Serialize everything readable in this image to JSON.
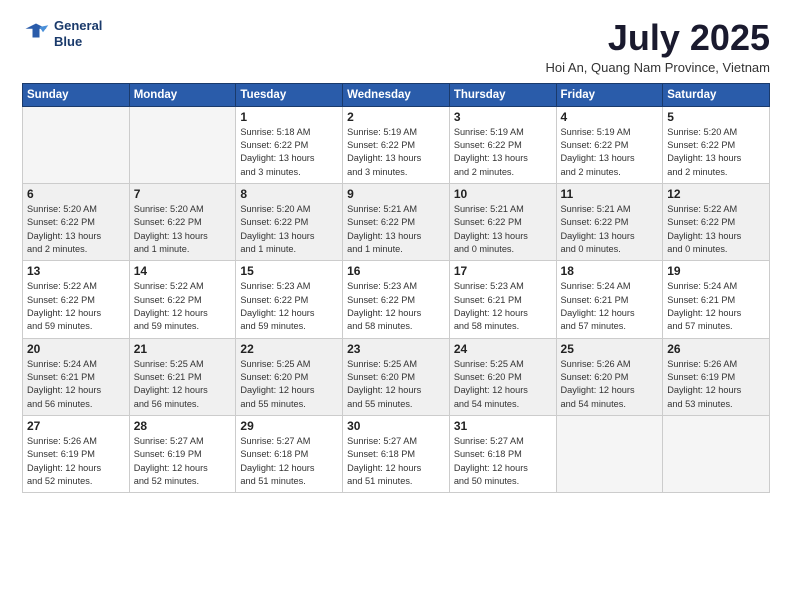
{
  "logo": {
    "line1": "General",
    "line2": "Blue"
  },
  "title": "July 2025",
  "subtitle": "Hoi An, Quang Nam Province, Vietnam",
  "weekdays": [
    "Sunday",
    "Monday",
    "Tuesday",
    "Wednesday",
    "Thursday",
    "Friday",
    "Saturday"
  ],
  "weeks": [
    [
      {
        "day": "",
        "info": ""
      },
      {
        "day": "",
        "info": ""
      },
      {
        "day": "1",
        "info": "Sunrise: 5:18 AM\nSunset: 6:22 PM\nDaylight: 13 hours\nand 3 minutes."
      },
      {
        "day": "2",
        "info": "Sunrise: 5:19 AM\nSunset: 6:22 PM\nDaylight: 13 hours\nand 3 minutes."
      },
      {
        "day": "3",
        "info": "Sunrise: 5:19 AM\nSunset: 6:22 PM\nDaylight: 13 hours\nand 2 minutes."
      },
      {
        "day": "4",
        "info": "Sunrise: 5:19 AM\nSunset: 6:22 PM\nDaylight: 13 hours\nand 2 minutes."
      },
      {
        "day": "5",
        "info": "Sunrise: 5:20 AM\nSunset: 6:22 PM\nDaylight: 13 hours\nand 2 minutes."
      }
    ],
    [
      {
        "day": "6",
        "info": "Sunrise: 5:20 AM\nSunset: 6:22 PM\nDaylight: 13 hours\nand 2 minutes."
      },
      {
        "day": "7",
        "info": "Sunrise: 5:20 AM\nSunset: 6:22 PM\nDaylight: 13 hours\nand 1 minute."
      },
      {
        "day": "8",
        "info": "Sunrise: 5:20 AM\nSunset: 6:22 PM\nDaylight: 13 hours\nand 1 minute."
      },
      {
        "day": "9",
        "info": "Sunrise: 5:21 AM\nSunset: 6:22 PM\nDaylight: 13 hours\nand 1 minute."
      },
      {
        "day": "10",
        "info": "Sunrise: 5:21 AM\nSunset: 6:22 PM\nDaylight: 13 hours\nand 0 minutes."
      },
      {
        "day": "11",
        "info": "Sunrise: 5:21 AM\nSunset: 6:22 PM\nDaylight: 13 hours\nand 0 minutes."
      },
      {
        "day": "12",
        "info": "Sunrise: 5:22 AM\nSunset: 6:22 PM\nDaylight: 13 hours\nand 0 minutes."
      }
    ],
    [
      {
        "day": "13",
        "info": "Sunrise: 5:22 AM\nSunset: 6:22 PM\nDaylight: 12 hours\nand 59 minutes."
      },
      {
        "day": "14",
        "info": "Sunrise: 5:22 AM\nSunset: 6:22 PM\nDaylight: 12 hours\nand 59 minutes."
      },
      {
        "day": "15",
        "info": "Sunrise: 5:23 AM\nSunset: 6:22 PM\nDaylight: 12 hours\nand 59 minutes."
      },
      {
        "day": "16",
        "info": "Sunrise: 5:23 AM\nSunset: 6:22 PM\nDaylight: 12 hours\nand 58 minutes."
      },
      {
        "day": "17",
        "info": "Sunrise: 5:23 AM\nSunset: 6:21 PM\nDaylight: 12 hours\nand 58 minutes."
      },
      {
        "day": "18",
        "info": "Sunrise: 5:24 AM\nSunset: 6:21 PM\nDaylight: 12 hours\nand 57 minutes."
      },
      {
        "day": "19",
        "info": "Sunrise: 5:24 AM\nSunset: 6:21 PM\nDaylight: 12 hours\nand 57 minutes."
      }
    ],
    [
      {
        "day": "20",
        "info": "Sunrise: 5:24 AM\nSunset: 6:21 PM\nDaylight: 12 hours\nand 56 minutes."
      },
      {
        "day": "21",
        "info": "Sunrise: 5:25 AM\nSunset: 6:21 PM\nDaylight: 12 hours\nand 56 minutes."
      },
      {
        "day": "22",
        "info": "Sunrise: 5:25 AM\nSunset: 6:20 PM\nDaylight: 12 hours\nand 55 minutes."
      },
      {
        "day": "23",
        "info": "Sunrise: 5:25 AM\nSunset: 6:20 PM\nDaylight: 12 hours\nand 55 minutes."
      },
      {
        "day": "24",
        "info": "Sunrise: 5:25 AM\nSunset: 6:20 PM\nDaylight: 12 hours\nand 54 minutes."
      },
      {
        "day": "25",
        "info": "Sunrise: 5:26 AM\nSunset: 6:20 PM\nDaylight: 12 hours\nand 54 minutes."
      },
      {
        "day": "26",
        "info": "Sunrise: 5:26 AM\nSunset: 6:19 PM\nDaylight: 12 hours\nand 53 minutes."
      }
    ],
    [
      {
        "day": "27",
        "info": "Sunrise: 5:26 AM\nSunset: 6:19 PM\nDaylight: 12 hours\nand 52 minutes."
      },
      {
        "day": "28",
        "info": "Sunrise: 5:27 AM\nSunset: 6:19 PM\nDaylight: 12 hours\nand 52 minutes."
      },
      {
        "day": "29",
        "info": "Sunrise: 5:27 AM\nSunset: 6:18 PM\nDaylight: 12 hours\nand 51 minutes."
      },
      {
        "day": "30",
        "info": "Sunrise: 5:27 AM\nSunset: 6:18 PM\nDaylight: 12 hours\nand 51 minutes."
      },
      {
        "day": "31",
        "info": "Sunrise: 5:27 AM\nSunset: 6:18 PM\nDaylight: 12 hours\nand 50 minutes."
      },
      {
        "day": "",
        "info": ""
      },
      {
        "day": "",
        "info": ""
      }
    ]
  ]
}
